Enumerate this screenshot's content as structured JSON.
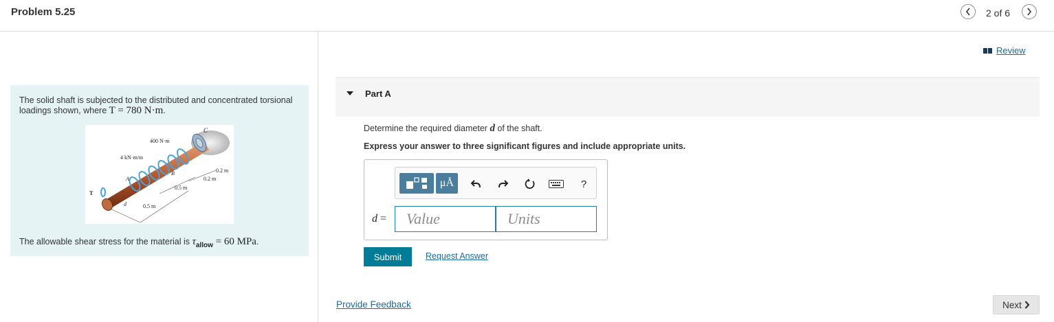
{
  "header": {
    "title": "Problem 5.25",
    "counter": "2 of 6",
    "prev_icon": "chevron-left-icon",
    "next_icon": "chevron-right-icon"
  },
  "problem": {
    "text1_a": "The solid shaft is subjected to the distributed and concentrated torsional loadings shown, where ",
    "text1_math": "T = 780 N·m",
    "text1_b": ".",
    "text2_a": "The allowable shear stress for the material is ",
    "text2_math": "τ",
    "text2_sub": "allow",
    "text2_math2": " = 60 MPa",
    "text2_b": ".",
    "figure": {
      "labels": {
        "c": "C",
        "load_top": "400 N·m",
        "dist_load": "4 kN·m/m",
        "b": "B",
        "a": "A",
        "t": "T",
        "d": "d",
        "dim1": "0.2 m",
        "dim2": "0.2 m",
        "dim3": "0.5 m",
        "dim4": "0.5 m"
      }
    }
  },
  "review": {
    "label": "Review",
    "icon": "book-icon"
  },
  "part": {
    "label": "Part A",
    "question_a": "Determine the required diameter ",
    "question_math": "d",
    "question_b": " of the shaft.",
    "instruction": "Express your answer to three significant figures and include appropriate units."
  },
  "answer": {
    "var_label": "d",
    "equals": " =",
    "value_placeholder": "Value",
    "units_placeholder": "Units",
    "toolbar": {
      "units_button": "μÅ",
      "help": "?"
    }
  },
  "actions": {
    "submit": "Submit",
    "request": "Request Answer",
    "feedback": "Provide Feedback",
    "next": "Next"
  },
  "colors": {
    "accent": "#007c99",
    "link": "#1a6c95",
    "panel_bg": "#e5f3f5",
    "toolbar_button": "#4a7e9c"
  }
}
